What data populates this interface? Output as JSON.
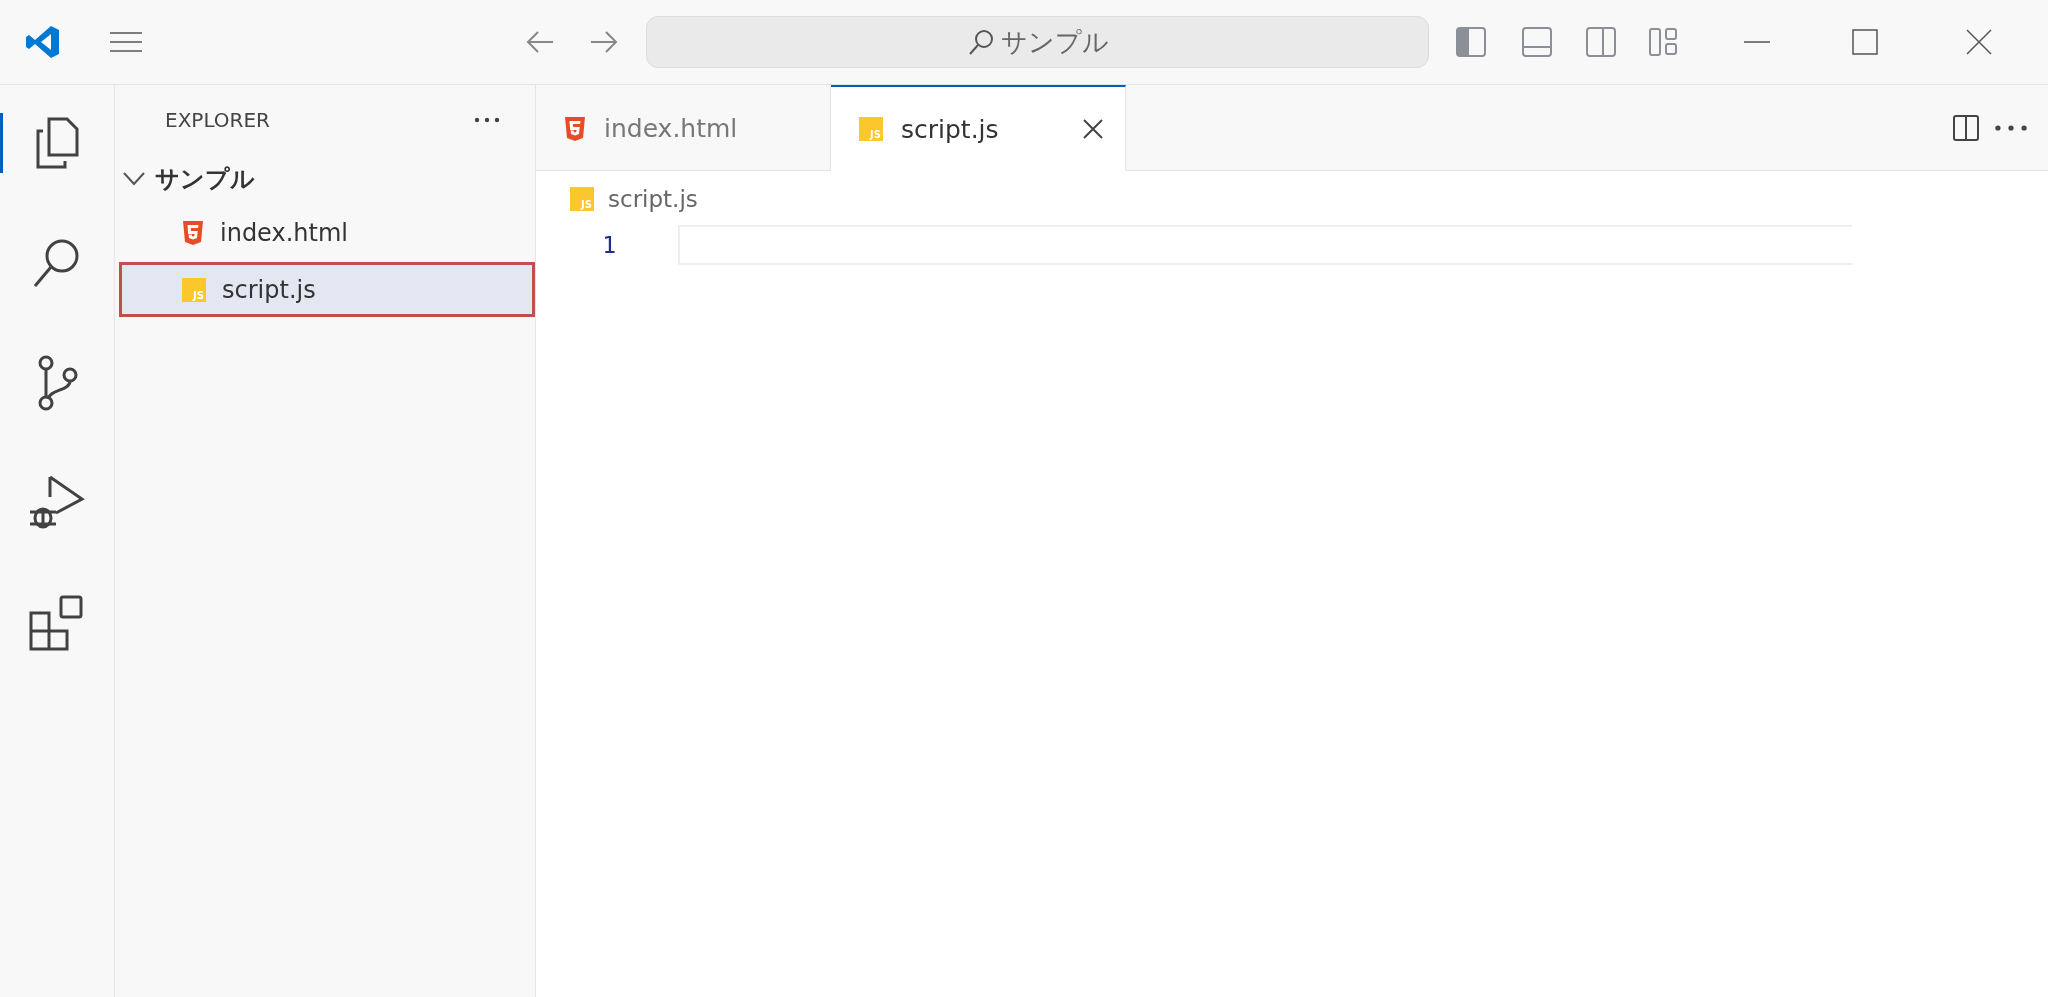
{
  "title_bar": {
    "search": "サンプル"
  },
  "activity_bar": [
    {
      "kind": "explorer",
      "selected": true
    },
    {
      "kind": "search",
      "selected": false
    },
    {
      "kind": "source-control",
      "selected": false
    },
    {
      "kind": "run-debug",
      "selected": false
    },
    {
      "kind": "extensions",
      "selected": false
    }
  ],
  "sidebar": {
    "title": "EXPLORER",
    "folder": {
      "name": "サンプル",
      "expanded": true,
      "children": [
        {
          "name": "index.html",
          "kind": "html",
          "selected": false
        },
        {
          "name": "script.js",
          "kind": "js",
          "icon_label": "JS",
          "selected": true
        }
      ]
    }
  },
  "tabs": [
    {
      "label": "index.html",
      "kind": "html",
      "selected": false
    },
    {
      "label": "script.js",
      "kind": "js",
      "icon_label": "JS",
      "selected": true
    }
  ],
  "breadcrumb": {
    "label": "script.js",
    "kind": "js",
    "icon_label": "JS"
  },
  "editor": {
    "line_numbers": [
      "1"
    ]
  }
}
